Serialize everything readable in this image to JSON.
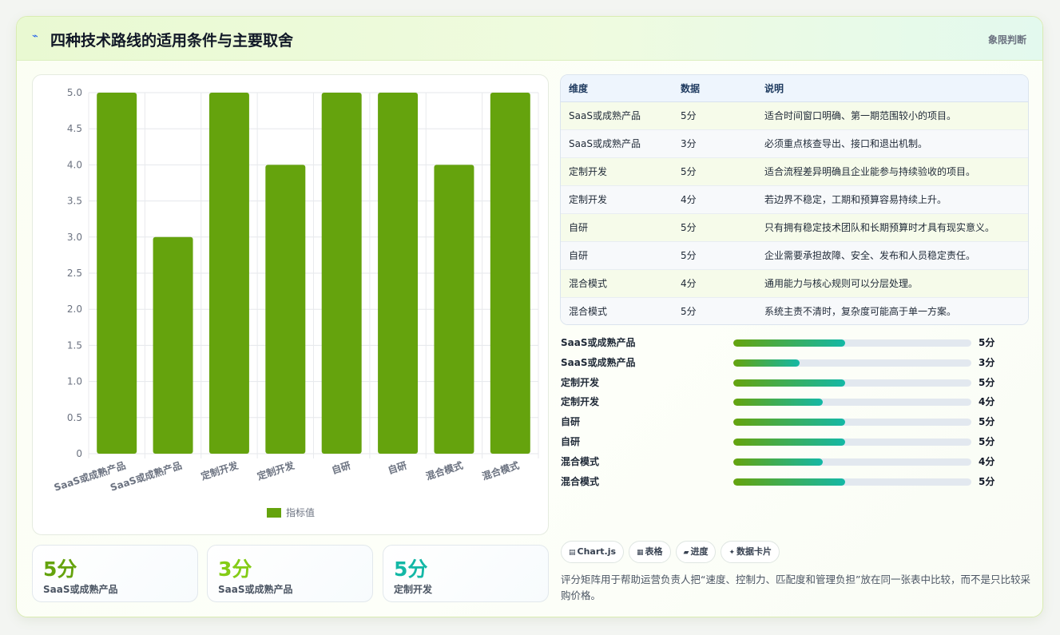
{
  "header": {
    "title": "四种技术路线的适用条件与主要取舍",
    "badge": "象限判断",
    "icon": "chart-icon"
  },
  "colors": {
    "bar": "#65a30d",
    "accent_green": "#65a30d",
    "accent_lime": "#84cc16",
    "accent_teal": "#14b8a6"
  },
  "chart_data": {
    "type": "bar",
    "categories": [
      "SaaS或成熟产品",
      "SaaS或成熟产品",
      "定制开发",
      "定制开发",
      "自研",
      "自研",
      "混合模式",
      "混合模式"
    ],
    "series": [
      {
        "name": "指标值",
        "values": [
          5,
          3,
          5,
          4,
          5,
          5,
          4,
          5
        ]
      }
    ],
    "ylim": [
      0,
      5
    ],
    "yticks": [
      "0",
      "0.5",
      "1.0",
      "1.5",
      "2.0",
      "2.5",
      "3.0",
      "3.5",
      "4.0",
      "4.5",
      "5.0"
    ],
    "grid": true,
    "legend": "bottom"
  },
  "stats": [
    {
      "value": "5分",
      "label": "SaaS或成熟产品"
    },
    {
      "value": "3分",
      "label": "SaaS或成熟产品"
    },
    {
      "value": "5分",
      "label": "定制开发"
    }
  ],
  "table": {
    "headers": [
      "维度",
      "数据",
      "说明"
    ],
    "rows": [
      [
        "SaaS或成熟产品",
        "5分",
        "适合时间窗口明确、第一期范围较小的项目。"
      ],
      [
        "SaaS或成熟产品",
        "3分",
        "必须重点核查导出、接口和退出机制。"
      ],
      [
        "定制开发",
        "5分",
        "适合流程差异明确且企业能参与持续验收的项目。"
      ],
      [
        "定制开发",
        "4分",
        "若边界不稳定，工期和预算容易持续上升。"
      ],
      [
        "自研",
        "5分",
        "只有拥有稳定技术团队和长期预算时才具有现实意义。"
      ],
      [
        "自研",
        "5分",
        "企业需要承担故障、安全、发布和人员稳定责任。"
      ],
      [
        "混合模式",
        "4分",
        "通用能力与核心规则可以分层处理。"
      ],
      [
        "混合模式",
        "5分",
        "系统主责不清时，复杂度可能高于单一方案。"
      ]
    ]
  },
  "progress": [
    {
      "label": "SaaS或成熟产品",
      "value": "5分",
      "fraction": 0.47
    },
    {
      "label": "SaaS或成熟产品",
      "value": "3分",
      "fraction": 0.28
    },
    {
      "label": "定制开发",
      "value": "5分",
      "fraction": 0.47
    },
    {
      "label": "定制开发",
      "value": "4分",
      "fraction": 0.375
    },
    {
      "label": "自研",
      "value": "5分",
      "fraction": 0.47
    },
    {
      "label": "自研",
      "value": "5分",
      "fraction": 0.47
    },
    {
      "label": "混合模式",
      "value": "4分",
      "fraction": 0.375
    },
    {
      "label": "混合模式",
      "value": "5分",
      "fraction": 0.47
    }
  ],
  "chips": [
    {
      "icon": "▤",
      "label": "Chart.js"
    },
    {
      "icon": "▦",
      "label": "表格"
    },
    {
      "icon": "▰",
      "label": "进度"
    },
    {
      "icon": "✦",
      "label": "数据卡片"
    }
  ],
  "footnote": "评分矩阵用于帮助运营负责人把“速度、控制力、匹配度和管理负担”放在同一张表中比较，而不是只比较采购价格。"
}
